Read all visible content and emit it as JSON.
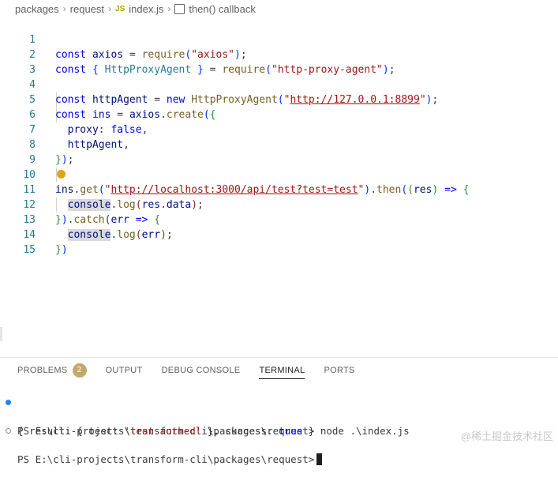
{
  "breadcrumb": {
    "items": [
      "packages",
      "request",
      "index.js",
      "then() callback"
    ],
    "file_lang": "JS"
  },
  "editor": {
    "line_numbers": [
      "1",
      "2",
      "3",
      "4",
      "5",
      "6",
      "7",
      "8",
      "9",
      "10",
      "11",
      "12",
      "13",
      "14",
      "15"
    ],
    "lines": {
      "l1": {
        "kw": "const",
        "var": "axios",
        "eq": " = ",
        "fn": "require",
        "open": "(",
        "str": "\"axios\"",
        "close": ");"
      },
      "l2": {
        "kw": "const",
        "open": "{ ",
        "cls": "HttpProxyAgent",
        "close": " }",
        "eq": " = ",
        "fn": "require",
        "p1": "(",
        "str": "\"http-proxy-agent\"",
        "p2": ");"
      },
      "l4": {
        "kw": "const",
        "var": "httpAgent",
        "eq": " = ",
        "kw2": "new",
        "cls": "HttpProxyAgent",
        "p1": "(",
        "q1": "\"",
        "url": "http://127.0.0.1:8899",
        "q2": "\"",
        "p2": ");"
      },
      "l5": {
        "kw": "const",
        "var": "ins",
        "eq": " = ",
        "var2": "axios",
        "dot": ".",
        "fn": "create",
        "p1": "(",
        "b": "{"
      },
      "l6": {
        "var": "proxy",
        "colon": ": ",
        "kw": "false",
        "comma": ","
      },
      "l7": {
        "var": "httpAgent",
        "comma": ","
      },
      "l8": {
        "b": "}",
        "p": ");"
      },
      "l10": {
        "var": "ins",
        "dot": ".",
        "fn": "get",
        "p1": "(",
        "q1": "\"",
        "url": "http://localhost:3000/api/test?test=test",
        "q2": "\"",
        "p2": ")",
        "dot2": ".",
        "fn2": "then",
        "p3": "(",
        "p4": "(",
        "var2": "res",
        "p5": ")",
        "arrow": " => ",
        "b": "{"
      },
      "l11": {
        "var": "console",
        "dot": ".",
        "fn": "log",
        "p1": "(",
        "var2": "res",
        "dot2": ".",
        "var3": "data",
        "p2": ");"
      },
      "l12": {
        "b": "}",
        "p1": ")",
        "dot": ".",
        "fn": "catch",
        "p2": "(",
        "var": "err",
        "arrow": " => ",
        "b2": "{"
      },
      "l13": {
        "var": "console",
        "dot": ".",
        "fn": "log",
        "p1": "(",
        "var2": "err",
        "p2": ");"
      },
      "l14": {
        "b": "}",
        "p": ")"
      }
    }
  },
  "panel": {
    "tabs": [
      "PROBLEMS",
      "OUTPUT",
      "DEBUG CONSOLE",
      "TERMINAL",
      "PORTS"
    ],
    "problems_count": "2",
    "active_tab": "TERMINAL"
  },
  "terminal": {
    "line1_prompt": "PS E:\\cli-projects\\transform-cli\\packages\\request> ",
    "line1_cmd": "node .\\index.js",
    "line2_a": "{ result: { test: ",
    "line2_str": "'test authed'",
    "line2_b": " }, success: ",
    "line2_kw": "true",
    "line2_c": " }",
    "line3_prompt": "PS E:\\cli-projects\\transform-cli\\packages\\request>"
  },
  "watermark": "@稀土掘金技术社区",
  "colors": {
    "keyword": "#0000ff",
    "function": "#795e26",
    "variable": "#001080",
    "string": "#a31515",
    "class": "#267f99",
    "line_number": "#237893",
    "problems_badge": "#c4a86a",
    "terminal_success_dot": "#1a85ff"
  }
}
